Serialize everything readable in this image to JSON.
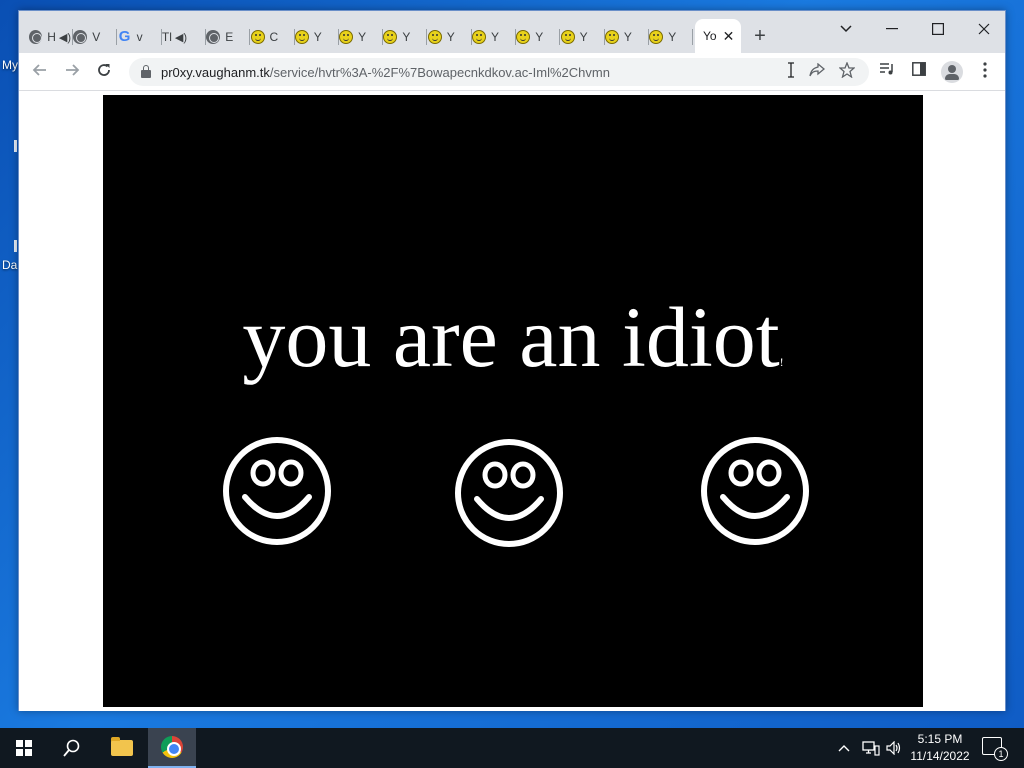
{
  "desktop": {
    "icon_labels": [
      "My",
      "Da"
    ]
  },
  "browser": {
    "tabs": [
      {
        "label": "H",
        "icon": "globe-icon",
        "audio": true
      },
      {
        "label": "V",
        "icon": "globe-icon",
        "audio": false
      },
      {
        "label": "v",
        "icon": "google-icon",
        "audio": false
      },
      {
        "label": "Tl",
        "icon": "none",
        "audio": true
      },
      {
        "label": "E",
        "icon": "globe-icon",
        "audio": false
      },
      {
        "label": "C",
        "icon": "smiley-icon",
        "audio": false
      },
      {
        "label": "Y",
        "icon": "smiley-icon",
        "audio": false
      },
      {
        "label": "Y",
        "icon": "smiley-icon",
        "audio": false
      },
      {
        "label": "Y",
        "icon": "smiley-icon",
        "audio": false
      },
      {
        "label": "Y",
        "icon": "smiley-icon",
        "audio": false
      },
      {
        "label": "Y",
        "icon": "smiley-icon",
        "audio": false
      },
      {
        "label": "Y",
        "icon": "smiley-icon",
        "audio": false
      },
      {
        "label": "Y",
        "icon": "smiley-icon",
        "audio": false
      },
      {
        "label": "Y",
        "icon": "smiley-icon",
        "audio": false
      },
      {
        "label": "Y",
        "icon": "smiley-icon",
        "audio": false
      }
    ],
    "active_tab": {
      "label": "Yo"
    },
    "address": {
      "host": "pr0xy.vaughanm.tk",
      "path": "/service/hvtr%3A-%2F%7Bowapecnkdkov.ac-Iml%2Chvmn"
    }
  },
  "page": {
    "headline": "you are an idiot",
    "headline_suffix": "!",
    "smiley_count": 3,
    "background_color": "#000000",
    "foreground_color": "#ffffff"
  },
  "taskbar": {
    "time": "5:15 PM",
    "date": "11/14/2022",
    "notification_count": "1"
  }
}
